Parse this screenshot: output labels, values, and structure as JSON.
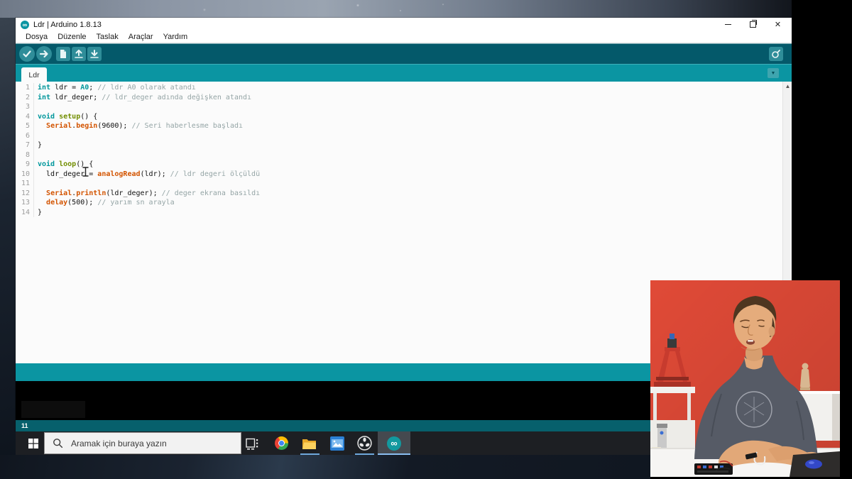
{
  "window": {
    "title": "Ldr | Arduino 1.8.13",
    "menu_items": [
      "Dosya",
      "Düzenle",
      "Taslak",
      "Araçlar",
      "Yardım"
    ],
    "tab_label": "Ldr",
    "footer_status": "11",
    "toolbar_buttons": [
      "verify",
      "upload",
      "new",
      "open",
      "save",
      "serial-monitor"
    ],
    "controls": [
      "minimize",
      "restore",
      "close"
    ]
  },
  "editor": {
    "lines": [
      {
        "n": "1",
        "toks": [
          [
            "k",
            "int"
          ],
          [
            "p",
            " ldr = "
          ],
          [
            "k",
            "A0"
          ],
          [
            "p",
            "; "
          ],
          [
            "m",
            "// ldr A0 olarak atandı"
          ]
        ]
      },
      {
        "n": "2",
        "toks": [
          [
            "k",
            "int"
          ],
          [
            "p",
            " ldr_deger; "
          ],
          [
            "m",
            "// ldr_deger adında değişken atandı"
          ]
        ]
      },
      {
        "n": "3",
        "toks": []
      },
      {
        "n": "4",
        "toks": [
          [
            "k",
            "void"
          ],
          [
            "p",
            " "
          ],
          [
            "f",
            "setup"
          ],
          [
            "p",
            "() {"
          ]
        ]
      },
      {
        "n": "5",
        "toks": [
          [
            "p",
            "  "
          ],
          [
            "o",
            "Serial"
          ],
          [
            "p",
            "."
          ],
          [
            "o",
            "begin"
          ],
          [
            "p",
            "(9600); "
          ],
          [
            "m",
            "// Seri haberlesme başladı"
          ]
        ]
      },
      {
        "n": "6",
        "toks": []
      },
      {
        "n": "7",
        "toks": [
          [
            "p",
            "}"
          ]
        ]
      },
      {
        "n": "8",
        "toks": []
      },
      {
        "n": "9",
        "toks": [
          [
            "k",
            "void"
          ],
          [
            "p",
            " "
          ],
          [
            "f",
            "loop"
          ],
          [
            "p",
            "() {"
          ]
        ]
      },
      {
        "n": "10",
        "toks": [
          [
            "p",
            "  ldr_deger = "
          ],
          [
            "o",
            "analogRead"
          ],
          [
            "p",
            "(ldr); "
          ],
          [
            "m",
            "// ldr degeri ölçüldü"
          ]
        ]
      },
      {
        "n": "11",
        "toks": []
      },
      {
        "n": "12",
        "toks": [
          [
            "p",
            "  "
          ],
          [
            "o",
            "Serial"
          ],
          [
            "p",
            "."
          ],
          [
            "o",
            "println"
          ],
          [
            "p",
            "(ldr_deger); "
          ],
          [
            "m",
            "// deger ekrana basıldı"
          ]
        ]
      },
      {
        "n": "13",
        "toks": [
          [
            "p",
            "  "
          ],
          [
            "o",
            "delay"
          ],
          [
            "p",
            "(500); "
          ],
          [
            "m",
            "// yarım sn arayla"
          ]
        ]
      },
      {
        "n": "14",
        "toks": [
          [
            "p",
            "}"
          ]
        ]
      }
    ]
  },
  "taskbar": {
    "search_placeholder": "Aramak için buraya yazın",
    "icons": [
      "start",
      "task-view",
      "chrome",
      "file-explorer",
      "photos",
      "obs-studio",
      "arduino"
    ],
    "active_apps": [
      "file-explorer",
      "obs-studio",
      "arduino"
    ]
  },
  "colors": {
    "teal_dark": "#04596a",
    "teal_mid": "#0b95a2",
    "teal_footer": "#07606c",
    "keyword": "#00979c",
    "function": "#728e00",
    "builtin": "#d35400",
    "comment": "#95a5a6",
    "indicator": "#6fa8dc",
    "webcam_wall": "#e04a37"
  }
}
